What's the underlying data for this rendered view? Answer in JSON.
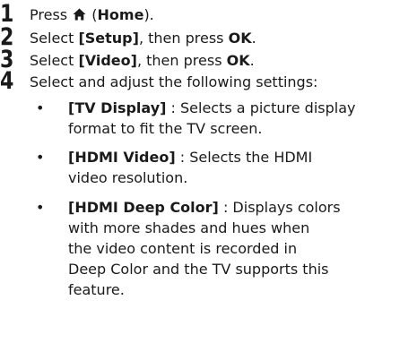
{
  "steps": [
    {
      "num": "1",
      "pre": "Press ",
      "icon": "home-icon",
      "mid": " (",
      "bold": "Home",
      "post": ")."
    },
    {
      "num": "2",
      "pre": "Select ",
      "bold1": "[Setup]",
      "mid": ", then press ",
      "bold2": "OK",
      "post": "."
    },
    {
      "num": "3",
      "pre": "Select ",
      "bold1": "[Video]",
      "mid": ", then press ",
      "bold2": "OK",
      "post": "."
    },
    {
      "num": "4",
      "text": "Select and adjust the following settings:"
    }
  ],
  "bullets": [
    {
      "symbol": "•",
      "term": "[TV Display]",
      "desc_first": " : Selects a picture display",
      "desc_rest": [
        "format to fit the TV screen."
      ]
    },
    {
      "symbol": "•",
      "term": "[HDMI Video]",
      "desc_first": " : Selects the HDMI",
      "desc_rest": [
        "video resolution."
      ]
    },
    {
      "symbol": "•",
      "term": "[HDMI Deep Color]",
      "desc_first": " : Displays colors",
      "desc_rest": [
        "with more shades and hues when",
        "the video content is recorded in",
        "Deep Color and the TV supports this",
        "feature."
      ]
    }
  ]
}
